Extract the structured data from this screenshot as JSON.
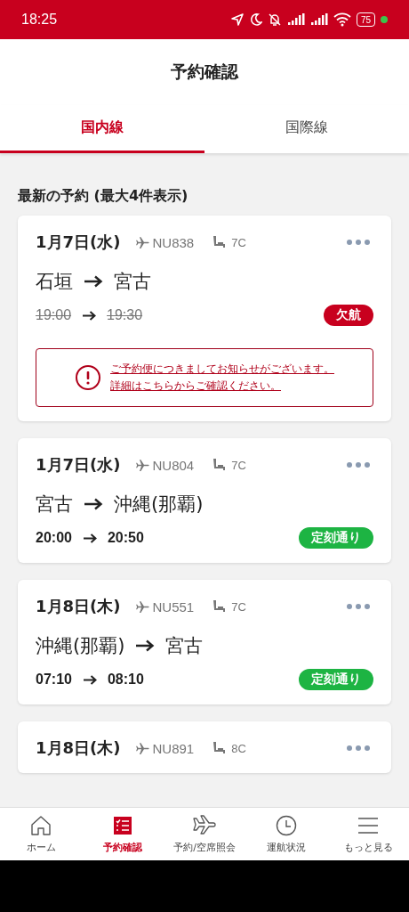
{
  "status_bar": {
    "time": "18:25",
    "battery": "75"
  },
  "header": {
    "title": "予約確認"
  },
  "tabs": [
    {
      "label": "国内線",
      "selected": true
    },
    {
      "label": "国際線",
      "selected": false
    }
  ],
  "section_title": "最新の予約 (最大4件表示)",
  "bookings": [
    {
      "date": "1月7日(水)",
      "flight": "NU838",
      "seat": "7C",
      "origin": "石垣",
      "destination": "宮古",
      "departure": "19:00",
      "arrival": "19:30",
      "cancelled": true,
      "status": {
        "label": "欠航",
        "color": "#c8001e"
      },
      "notice": [
        "ご予約便につきましてお知らせがございます。",
        "詳細はこちらからご確認ください。"
      ]
    },
    {
      "date": "1月7日(水)",
      "flight": "NU804",
      "seat": "7C",
      "origin": "宮古",
      "destination": "沖縄(那覇)",
      "departure": "20:00",
      "arrival": "20:50",
      "cancelled": false,
      "status": {
        "label": "定刻通り",
        "color": "#1db443"
      }
    },
    {
      "date": "1月8日(木)",
      "flight": "NU551",
      "seat": "7C",
      "origin": "沖縄(那覇)",
      "destination": "宮古",
      "departure": "07:10",
      "arrival": "08:10",
      "cancelled": false,
      "status": {
        "label": "定刻通り",
        "color": "#1db443"
      }
    },
    {
      "date": "1月8日(木)",
      "flight": "NU891",
      "seat": "8C"
    }
  ],
  "bottom_nav": [
    {
      "label": "ホーム",
      "selected": false
    },
    {
      "label": "予約確認",
      "selected": true
    },
    {
      "label": "予約/空席照会",
      "selected": false
    },
    {
      "label": "運航状況",
      "selected": false
    },
    {
      "label": "もっと見る",
      "selected": false
    }
  ]
}
